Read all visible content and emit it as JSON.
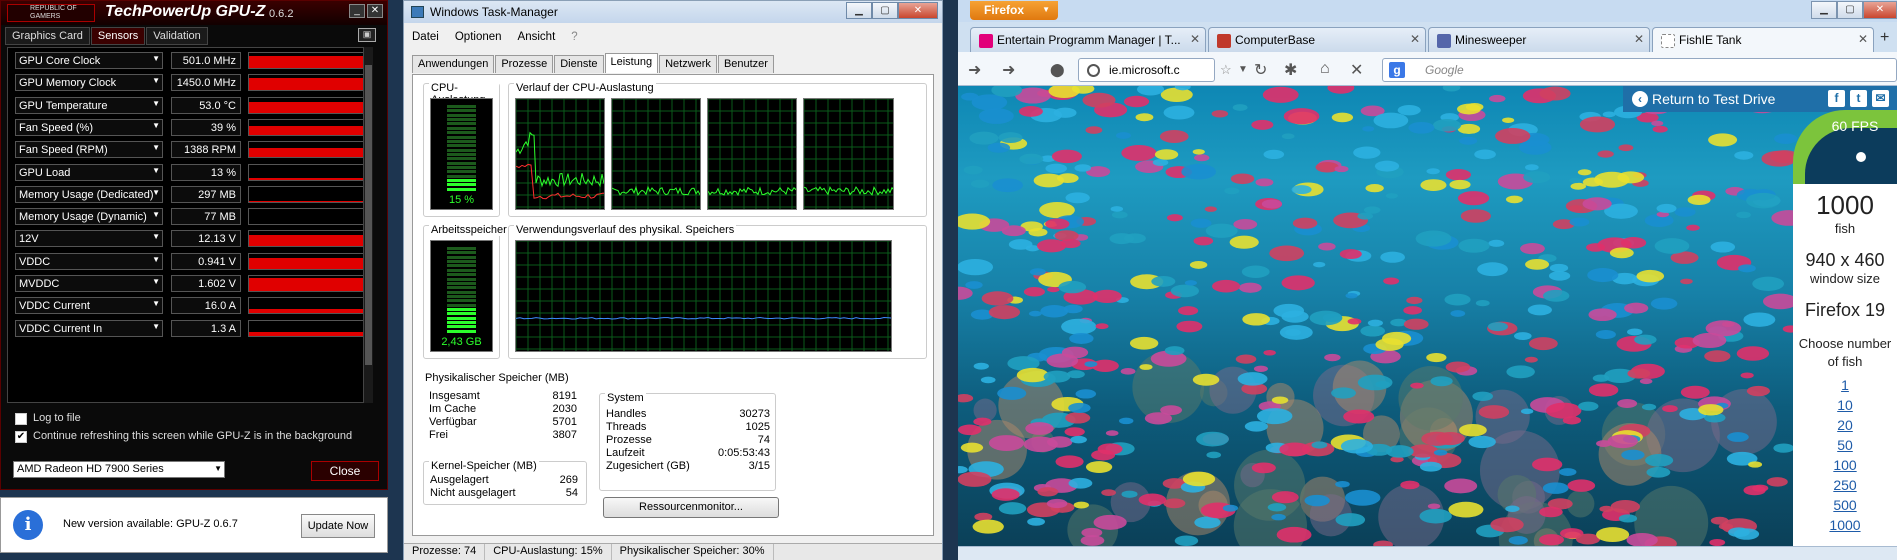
{
  "gpuz": {
    "app_name": "TechPowerUp GPU-Z",
    "version": "0.6.2",
    "logo_text": "REPUBLIC OF GAMERS",
    "tabs": [
      "Graphics Card",
      "Sensors",
      "Validation"
    ],
    "active_tab": "Sensors",
    "sensors": [
      {
        "label": "GPU Core Clock",
        "value": "501.0 MHz",
        "level": 0.8
      },
      {
        "label": "GPU Memory Clock",
        "value": "1450.0 MHz",
        "level": 0.85
      },
      {
        "label": "GPU Temperature",
        "value": "53.0 °C",
        "level": 0.7
      },
      {
        "label": "Fan Speed (%)",
        "value": "39 %",
        "level": 0.6
      },
      {
        "label": "Fan Speed (RPM)",
        "value": "1388 RPM",
        "level": 0.6
      },
      {
        "label": "GPU Load",
        "value": "13 %",
        "level": 0.1
      },
      {
        "label": "Memory Usage (Dedicated)",
        "value": "297 MB",
        "level": 0.05
      },
      {
        "label": "Memory Usage (Dynamic)",
        "value": "77 MB",
        "level": 0.0
      },
      {
        "label": "12V",
        "value": "12.13 V",
        "level": 0.75
      },
      {
        "label": "VDDC",
        "value": "0.941 V",
        "level": 0.7
      },
      {
        "label": "MVDDC",
        "value": "1.602 V",
        "level": 0.85
      },
      {
        "label": "VDDC Current",
        "value": "16.0 A",
        "level": 0.3
      },
      {
        "label": "VDDC Current In",
        "value": "1.3 A",
        "level": 0.25
      }
    ],
    "log_to_file": "Log to file",
    "continue_refresh": "Continue refreshing this screen while GPU-Z is in the background",
    "gpu_select": "AMD Radeon HD 7900 Series",
    "close_label": "Close",
    "accent": "#e00000"
  },
  "update": {
    "message": "New version available: GPU-Z 0.6.7",
    "button": "Update Now"
  },
  "taskmgr": {
    "title": "Windows Task-Manager",
    "menu": [
      "Datei",
      "Optionen",
      "Ansicht",
      "?"
    ],
    "tabs": [
      "Anwendungen",
      "Prozesse",
      "Dienste",
      "Leistung",
      "Netzwerk",
      "Benutzer"
    ],
    "active_tab": "Leistung",
    "cpu_usage_label": "CPU-Auslastung",
    "cpu_usage_value": "15 %",
    "cpu_level": 0.15,
    "cpu_history_label": "Verlauf der CPU-Auslastung",
    "memory_label": "Arbeitsspeicher",
    "memory_value": "2,43 GB",
    "memory_level": 0.3,
    "memory_history_label": "Verwendungsverlauf des physikal. Speichers",
    "physical": {
      "title": "Physikalischer Speicher (MB)",
      "rows": [
        {
          "k": "Insgesamt",
          "v": "8191"
        },
        {
          "k": "Im Cache",
          "v": "2030"
        },
        {
          "k": "Verfügbar",
          "v": "5701"
        },
        {
          "k": "Frei",
          "v": "3807"
        }
      ]
    },
    "kernel": {
      "title": "Kernel-Speicher (MB)",
      "rows": [
        {
          "k": "Ausgelagert",
          "v": "269"
        },
        {
          "k": "Nicht ausgelagert",
          "v": "54"
        }
      ]
    },
    "system": {
      "title": "System",
      "rows": [
        {
          "k": "Handles",
          "v": "30273"
        },
        {
          "k": "Threads",
          "v": "1025"
        },
        {
          "k": "Prozesse",
          "v": "74"
        },
        {
          "k": "Laufzeit",
          "v": "0:05:53:43"
        },
        {
          "k": "Zugesichert (GB)",
          "v": "3/15"
        }
      ]
    },
    "resource_button": "Ressourcenmonitor...",
    "status": [
      "Prozesse: 74",
      "CPU-Auslastung: 15%",
      "Physikalischer Speicher: 30%"
    ]
  },
  "firefox": {
    "menu_button": "Firefox",
    "tabs": [
      {
        "title": "Entertain Programm Manager | T...",
        "icon_color": "#e2007a"
      },
      {
        "title": "ComputerBase",
        "icon_color": "#c0392b"
      },
      {
        "title": "Minesweeper",
        "icon_color": "#5566aa"
      },
      {
        "title": "FishIE Tank",
        "icon_color": "#ffffff"
      }
    ],
    "active_tab": "FishIE Tank",
    "url": "ie.microsoft.c",
    "search_placeholder": "Google",
    "return_link": "Return to Test Drive",
    "fps": "60 FPS",
    "fish_count": "1000",
    "fish_label": "fish",
    "window_size": "940 x 460",
    "window_size_label": "window size",
    "browser": "Firefox 19",
    "choose_label": "Choose number of fish",
    "fish_options": [
      "1",
      "10",
      "20",
      "50",
      "100",
      "250",
      "500",
      "1000"
    ],
    "social": [
      "f",
      "t",
      "✉"
    ]
  }
}
